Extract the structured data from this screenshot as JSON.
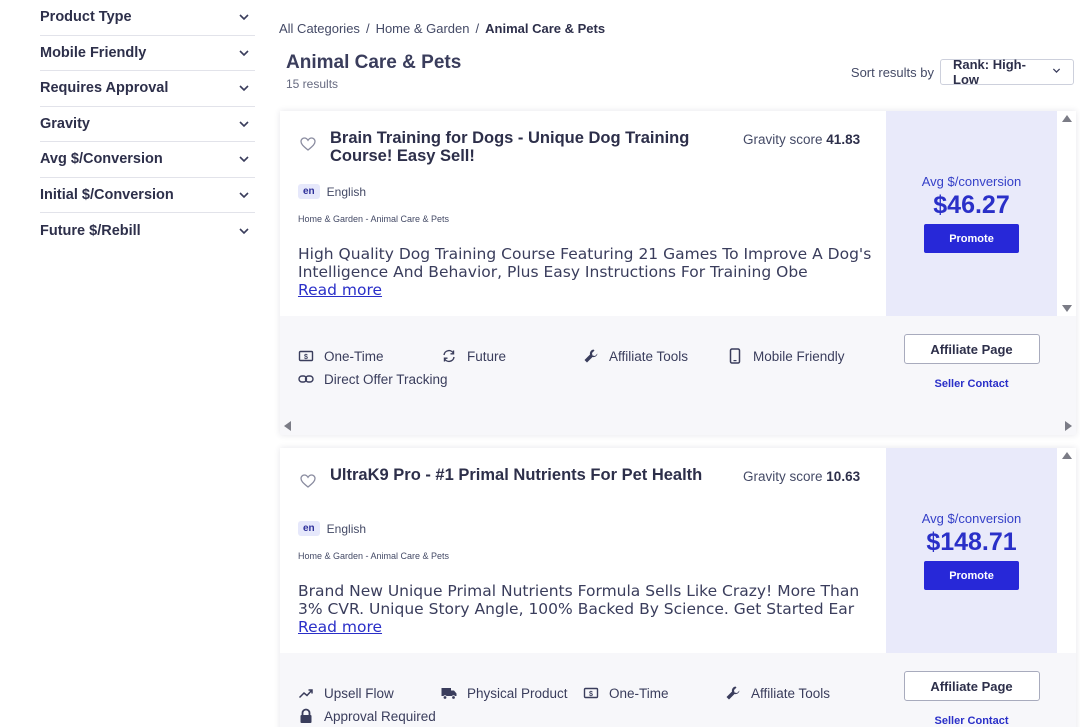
{
  "filters": [
    {
      "label": "Product Type"
    },
    {
      "label": "Mobile Friendly"
    },
    {
      "label": "Requires Approval"
    },
    {
      "label": "Gravity"
    },
    {
      "label": "Avg $/Conversion"
    },
    {
      "label": "Initial $/Conversion"
    },
    {
      "label": "Future $/Rebill"
    }
  ],
  "breadcrumb": [
    {
      "label": "All Categories"
    },
    {
      "label": "Home & Garden"
    },
    {
      "label": "Animal Care & Pets"
    }
  ],
  "breadcrumb_sep": "/",
  "page": {
    "title": "Animal Care & Pets",
    "results": "15 results"
  },
  "sort": {
    "label": "Sort results by",
    "value": "Rank: High-Low"
  },
  "products": [
    {
      "title": "Brain Training for Dogs - Unique Dog Training Course! Easy Sell!",
      "gravity_label": "Gravity score",
      "gravity_value": "41.83",
      "lang_code": "en",
      "lang": "English",
      "category": "Home & Garden - Animal Care & Pets",
      "description": "High Quality Dog Training Course Featuring 21 Games To Improve A Dog's Intelligence And Behavior, Plus Easy Instructions For Training Obe",
      "read_more": "Read more",
      "avg_label": "Avg $/conversion",
      "avg_value": "$46.27",
      "promote": "Promote",
      "features": [
        {
          "label": "One-Time",
          "icon": "dollar-bill-icon"
        },
        {
          "label": "Future",
          "icon": "recurring-icon"
        },
        {
          "label": "Affiliate Tools",
          "icon": "wrench-icon"
        },
        {
          "label": "Mobile Friendly",
          "icon": "mobile-icon"
        },
        {
          "label": "Direct Offer Tracking",
          "icon": "link-icon"
        }
      ],
      "affiliate_page": "Affiliate Page",
      "seller_contact": "Seller Contact"
    },
    {
      "title": "UltraK9 Pro - #1 Primal Nutrients For Pet Health",
      "gravity_label": "Gravity score",
      "gravity_value": "10.63",
      "lang_code": "en",
      "lang": "English",
      "category": "Home & Garden - Animal Care & Pets",
      "description": "Brand New Unique Primal Nutrients Formula Sells Like Crazy! More Than 3% CVR. Unique Story Angle, 100% Backed By Science. Get Started Ear",
      "read_more": "Read more",
      "avg_label": "Avg $/conversion",
      "avg_value": "$148.71",
      "promote": "Promote",
      "features": [
        {
          "label": "Upsell Flow",
          "icon": "trending-up-icon"
        },
        {
          "label": "Physical Product",
          "icon": "truck-icon"
        },
        {
          "label": "One-Time",
          "icon": "dollar-bill-icon"
        },
        {
          "label": "Affiliate Tools",
          "icon": "wrench-icon"
        },
        {
          "label": "Approval Required",
          "icon": "lock-icon"
        }
      ],
      "affiliate_page": "Affiliate Page",
      "seller_contact": "Seller Contact"
    }
  ]
}
